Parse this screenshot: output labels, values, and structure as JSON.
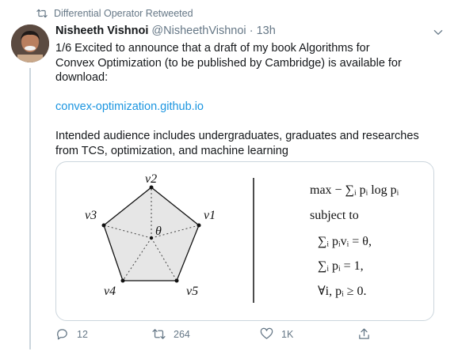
{
  "retweet": {
    "text": "Differential Operator Retweeted"
  },
  "author": {
    "name": "Nisheeth Vishnoi",
    "handle": "@NisheethVishnoi",
    "separator": "·",
    "time": "13h"
  },
  "tweet": {
    "lines": [
      "1/6 Excited to announce that a draft of my book Algorithms for",
      "Convex Optimization (to be published by Cambridge) is available for",
      "download:"
    ],
    "link": "convex-optimization.github.io",
    "audience_lines": [
      "Intended audience includes undergraduates, graduates and researches",
      "from TCS, optimization, and machine learning"
    ]
  },
  "figure": {
    "vertex_labels": [
      "v1",
      "v2",
      "v3",
      "v4",
      "v5"
    ],
    "center_label": "θ",
    "objective": "max − ∑ᵢ pᵢ log pᵢ",
    "subject_to": "subject to",
    "constraints": [
      "∑ᵢ pᵢvᵢ = θ,",
      "∑ᵢ pᵢ = 1,",
      "∀i,  pᵢ ≥ 0."
    ]
  },
  "actions": {
    "replies": "12",
    "retweets": "264",
    "likes": "1K"
  },
  "colors": {
    "link": "#1b95e0",
    "muted": "#657786",
    "border": "#ccd6dd",
    "pentagon_fill": "#e6e6e6"
  }
}
